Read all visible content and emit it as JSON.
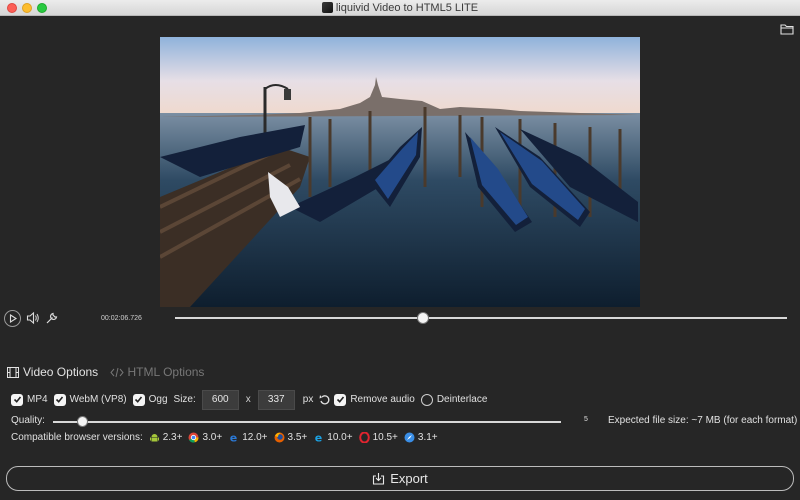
{
  "window": {
    "title": "liquivid Video to HTML5 LITE"
  },
  "player": {
    "timecode": "00:02:06.726",
    "seek_fraction": 0.405
  },
  "tabs": [
    {
      "label": "Video Options",
      "active": true
    },
    {
      "label": "HTML Options",
      "active": false
    }
  ],
  "options": {
    "mp4_label": "MP4",
    "webm_label": "WebM (VP8)",
    "ogg_label": "Ogg",
    "size_label": "Size:",
    "width": "600",
    "x_label": "x",
    "height": "337",
    "px_label": "px",
    "remove_audio_label": "Remove audio",
    "deinterlace_label": "Deinterlace"
  },
  "quality": {
    "label": "Quality:",
    "value": "5",
    "slider_fraction": 0.04,
    "expected_label": "Expected file size:",
    "expected_value": "~7 MB",
    "expected_note": "(for each format)"
  },
  "browsers": {
    "label": "Compatible browser versions:",
    "items": [
      {
        "icon": "android-icon",
        "version": "2.3+"
      },
      {
        "icon": "chrome-icon",
        "version": "3.0+"
      },
      {
        "icon": "ie-icon",
        "version": "12.0+"
      },
      {
        "icon": "firefox-icon",
        "version": "3.5+"
      },
      {
        "icon": "ie-icon",
        "version": "10.0+"
      },
      {
        "icon": "opera-icon",
        "version": "10.5+"
      },
      {
        "icon": "safari-icon",
        "version": "3.1+"
      }
    ]
  },
  "export": {
    "label": "Export"
  }
}
